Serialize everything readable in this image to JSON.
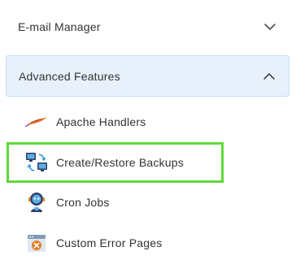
{
  "sections": {
    "email_manager": {
      "label": "E-mail Manager",
      "state": "collapsed"
    },
    "advanced_features": {
      "label": "Advanced Features",
      "state": "expanded"
    }
  },
  "menu": {
    "items": [
      {
        "label": "Apache Handlers",
        "icon": "feather-icon"
      },
      {
        "label": "Create/Restore Backups",
        "icon": "computers-sync-icon",
        "highlighted": true
      },
      {
        "label": "Cron Jobs",
        "icon": "robot-icon"
      },
      {
        "label": "Custom Error Pages",
        "icon": "error-page-icon"
      }
    ]
  },
  "colors": {
    "highlight_border": "#5fd93a",
    "expanded_bg": "#e8f1fb"
  }
}
